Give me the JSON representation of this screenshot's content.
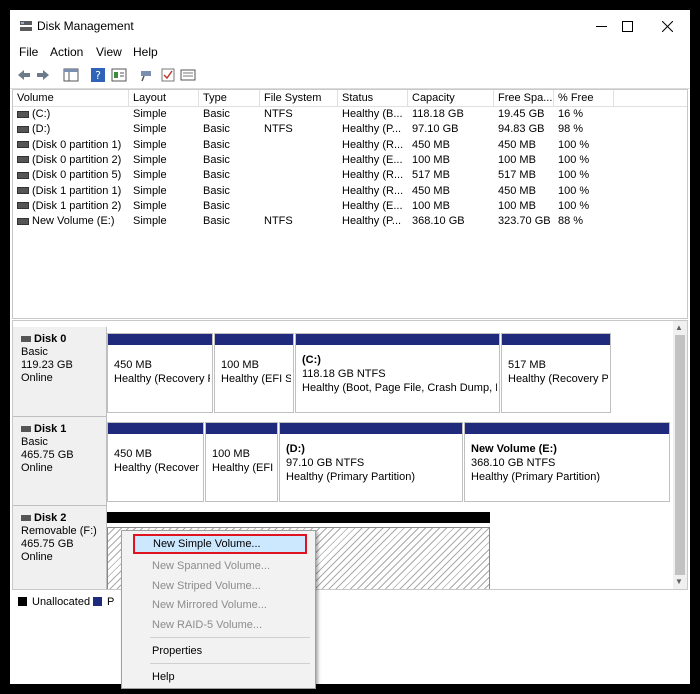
{
  "window": {
    "title": "Disk Management"
  },
  "menu": [
    "File",
    "Action",
    "View",
    "Help"
  ],
  "columns": [
    "Volume",
    "Layout",
    "Type",
    "File System",
    "Status",
    "Capacity",
    "Free Spa...",
    "% Free"
  ],
  "volumes": [
    [
      "(C:)",
      "Simple",
      "Basic",
      "NTFS",
      "Healthy (B...",
      "118.18 GB",
      "19.45 GB",
      "16 %"
    ],
    [
      "(D:)",
      "Simple",
      "Basic",
      "NTFS",
      "Healthy (P...",
      "97.10 GB",
      "94.83 GB",
      "98 %"
    ],
    [
      "(Disk 0 partition 1)",
      "Simple",
      "Basic",
      "",
      "Healthy (R...",
      "450 MB",
      "450 MB",
      "100 %"
    ],
    [
      "(Disk 0 partition 2)",
      "Simple",
      "Basic",
      "",
      "Healthy (E...",
      "100 MB",
      "100 MB",
      "100 %"
    ],
    [
      "(Disk 0 partition 5)",
      "Simple",
      "Basic",
      "",
      "Healthy (R...",
      "517 MB",
      "517 MB",
      "100 %"
    ],
    [
      "(Disk 1 partition 1)",
      "Simple",
      "Basic",
      "",
      "Healthy (R...",
      "450 MB",
      "450 MB",
      "100 %"
    ],
    [
      "(Disk 1 partition 2)",
      "Simple",
      "Basic",
      "",
      "Healthy (E...",
      "100 MB",
      "100 MB",
      "100 %"
    ],
    [
      "New Volume (E:)",
      "Simple",
      "Basic",
      "NTFS",
      "Healthy (P...",
      "368.10 GB",
      "323.70 GB",
      "88 %"
    ]
  ],
  "disks": [
    {
      "name": "Disk 0",
      "type": "Basic",
      "size": "119.23 GB",
      "state": "Online",
      "partitions": [
        {
          "name": "",
          "size": "450 MB",
          "status": "Healthy (Recovery P"
        },
        {
          "name": "",
          "size": "100 MB",
          "status": "Healthy (EFI S"
        },
        {
          "name": "(C:)",
          "size": "118.18 GB NTFS",
          "status": "Healthy (Boot, Page File, Crash Dump, P"
        },
        {
          "name": "",
          "size": "517 MB",
          "status": "Healthy (Recovery P"
        }
      ]
    },
    {
      "name": "Disk 1",
      "type": "Basic",
      "size": "465.75 GB",
      "state": "Online",
      "partitions": [
        {
          "name": "",
          "size": "450 MB",
          "status": "Healthy (Recover"
        },
        {
          "name": "",
          "size": "100 MB",
          "status": "Healthy (EFI"
        },
        {
          "name": "(D:)",
          "size": "97.10 GB NTFS",
          "status": "Healthy (Primary Partition)"
        },
        {
          "name": "New Volume  (E:)",
          "size": "368.10 GB NTFS",
          "status": "Healthy (Primary Partition)"
        }
      ]
    },
    {
      "name": "Disk 2",
      "type": "Removable (F:)",
      "size": "465.75 GB",
      "state": "Online"
    }
  ],
  "legend": {
    "unallocated": "Unallocated",
    "primary": "P"
  },
  "context_menu": {
    "items": [
      {
        "label": "New Simple Volume...",
        "enabled": true,
        "highlighted": true
      },
      {
        "label": "New Spanned Volume...",
        "enabled": false
      },
      {
        "label": "New Striped Volume...",
        "enabled": false
      },
      {
        "label": "New Mirrored Volume...",
        "enabled": false
      },
      {
        "label": "New RAID-5 Volume...",
        "enabled": false
      },
      {
        "label": "Properties",
        "enabled": true
      },
      {
        "label": "Help",
        "enabled": true
      }
    ]
  },
  "colors": {
    "primary_bar": "#1f2a7c",
    "unallocated_bar": "#000000",
    "highlight_border": "#e0141e",
    "highlight_bg": "#cce8ff"
  },
  "icons": {
    "toolbar": [
      "back-arrow-icon",
      "forward-arrow-icon",
      "show-hide-console-tree-icon",
      "help-icon",
      "properties-icon",
      "connect-icon",
      "check-icon",
      "view-icon"
    ]
  }
}
